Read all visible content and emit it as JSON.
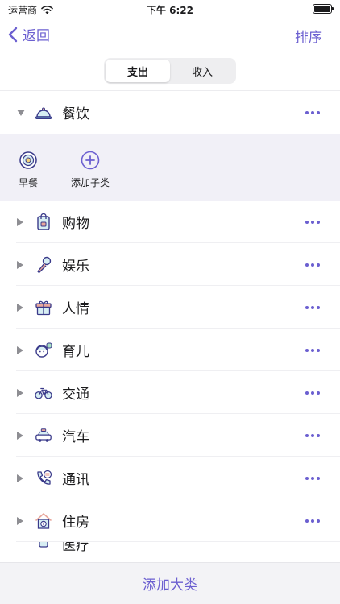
{
  "status_bar": {
    "carrier": "运营商",
    "time": "下午 6:22"
  },
  "nav": {
    "back_label": "返回",
    "sort_label": "排序"
  },
  "segments": [
    {
      "label": "支出",
      "active": true
    },
    {
      "label": "收入",
      "active": false
    }
  ],
  "categories": [
    {
      "label": "餐饮",
      "icon": "food-cloche-icon",
      "expanded": true
    },
    {
      "label": "购物",
      "icon": "shopping-bag-icon"
    },
    {
      "label": "娱乐",
      "icon": "microphone-icon"
    },
    {
      "label": "人情",
      "icon": "gift-icon"
    },
    {
      "label": "育儿",
      "icon": "baby-icon"
    },
    {
      "label": "交通",
      "icon": "bicycle-icon"
    },
    {
      "label": "汽车",
      "icon": "taxi-icon"
    },
    {
      "label": "通讯",
      "icon": "phone-icon"
    },
    {
      "label": "住房",
      "icon": "house-icon"
    },
    {
      "label": "医疗",
      "icon": "medical-icon"
    }
  ],
  "subcategories": [
    {
      "label": "早餐",
      "icon": "breakfast-icon"
    },
    {
      "label": "添加子类",
      "icon": "add-circle-icon"
    }
  ],
  "bottom": {
    "add_label": "添加大类"
  },
  "colors": {
    "accent": "#6b5fd0",
    "icon_secondary": "#7ac4d6",
    "icon_highlight": "#e8a79c"
  }
}
